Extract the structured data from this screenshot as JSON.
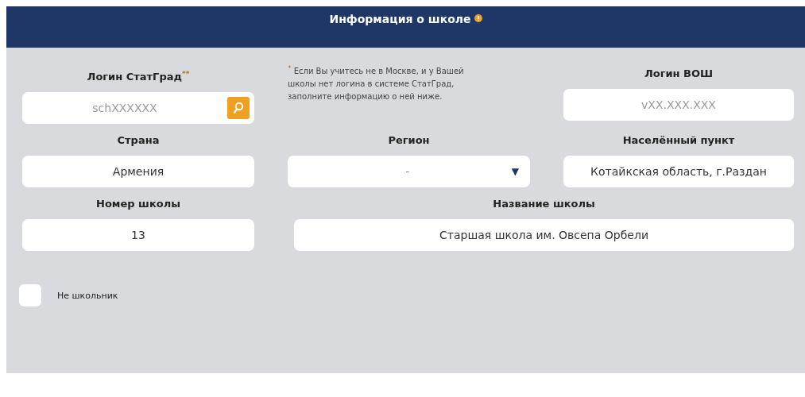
{
  "header": {
    "title": "Информация о школе"
  },
  "rows": [
    [
      {
        "kind": "search",
        "label": "Логин СтатГрад$^{**}$",
        "placeholder": "schXXXXXX"
      },
      {
        "kind": "note",
        "text": "$^{*}$ Если Вы учитесь не в Москве, и у Вашей школы нет логина в системе СтатГрад, заполните информацию о ней ниже."
      },
      {
        "kind": "text",
        "label": "Логин ВОШ",
        "placeholder": "vXX.XXX.XXX"
      }
    ],
    [
      {
        "kind": "text",
        "label": "Страна",
        "value": "Армения"
      },
      {
        "kind": "select",
        "label": "Регион",
        "value": "-",
        "arrow": "▼"
      },
      {
        "kind": "text",
        "label": "Населённый пункт",
        "value": "Котайкская область, г.Раздан"
      }
    ],
    [
      {
        "kind": "text",
        "label": "Номер школы",
        "value": "13"
      },
      {
        "kind": "text",
        "label": "Название школы",
        "value": "Старшая школа им. Овсепа Орбели"
      }
    ]
  ],
  "checkbox": {
    "label": "Не школьник",
    "checked": false
  }
}
